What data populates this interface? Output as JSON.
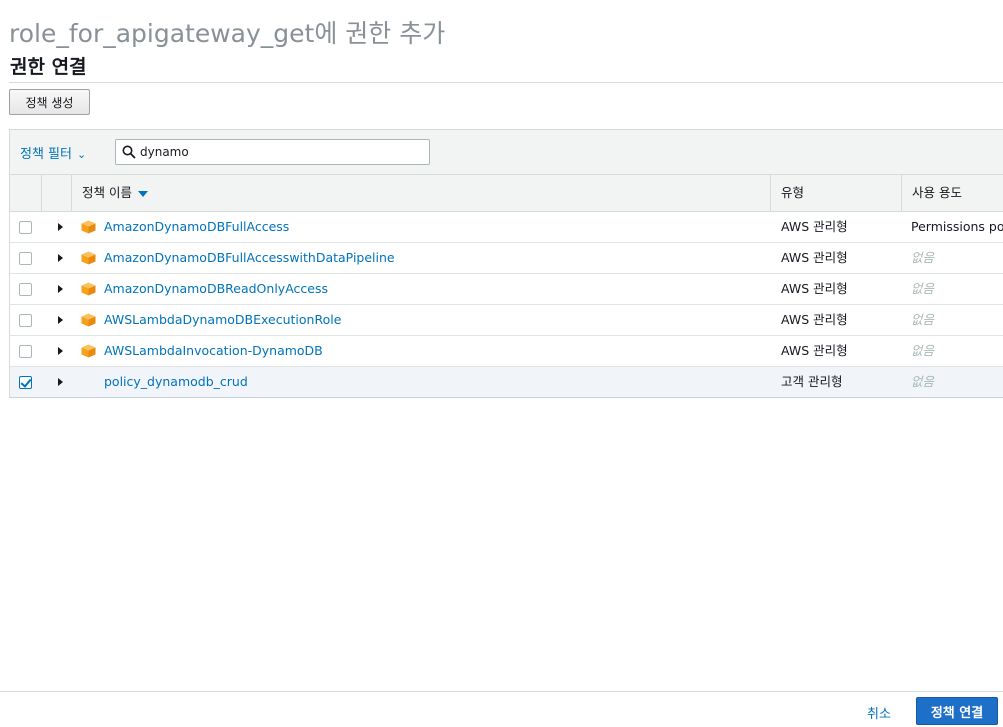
{
  "page": {
    "title": "role_for_apigateway_get에 권한 추가",
    "section_title": "권한 연결",
    "create_policy_label": "정책 생성"
  },
  "filter": {
    "dropdown_label": "정책 필터",
    "search_value": "dynamo",
    "search_icon": "search-icon"
  },
  "table": {
    "columns": {
      "name": "정책 이름",
      "type": "유형",
      "usage": "사용 용도"
    },
    "sort": {
      "column": "name",
      "direction": "descending"
    },
    "rows": [
      {
        "checked": false,
        "aws_icon": true,
        "name": "AmazonDynamoDBFullAccess",
        "type": "AWS 관리형",
        "usage": "Permissions poli",
        "usage_none": false
      },
      {
        "checked": false,
        "aws_icon": true,
        "name": "AmazonDynamoDBFullAccesswithDataPipeline",
        "type": "AWS 관리형",
        "usage": "없음",
        "usage_none": true
      },
      {
        "checked": false,
        "aws_icon": true,
        "name": "AmazonDynamoDBReadOnlyAccess",
        "type": "AWS 관리형",
        "usage": "없음",
        "usage_none": true
      },
      {
        "checked": false,
        "aws_icon": true,
        "name": "AWSLambdaDynamoDBExecutionRole",
        "type": "AWS 관리형",
        "usage": "없음",
        "usage_none": true
      },
      {
        "checked": false,
        "aws_icon": true,
        "name": "AWSLambdaInvocation-DynamoDB",
        "type": "AWS 관리형",
        "usage": "없음",
        "usage_none": true
      },
      {
        "checked": true,
        "aws_icon": false,
        "name": "policy_dynamodb_crud",
        "type": "고객 관리형",
        "usage": "없음",
        "usage_none": true
      }
    ]
  },
  "footer": {
    "cancel_label": "취소",
    "attach_label": "정책 연결"
  },
  "colors": {
    "link": "#0073bb",
    "primary_button": "#1e6fc7",
    "aws_icon": "#f7a11a",
    "selected_row": "#f1f4f8"
  }
}
